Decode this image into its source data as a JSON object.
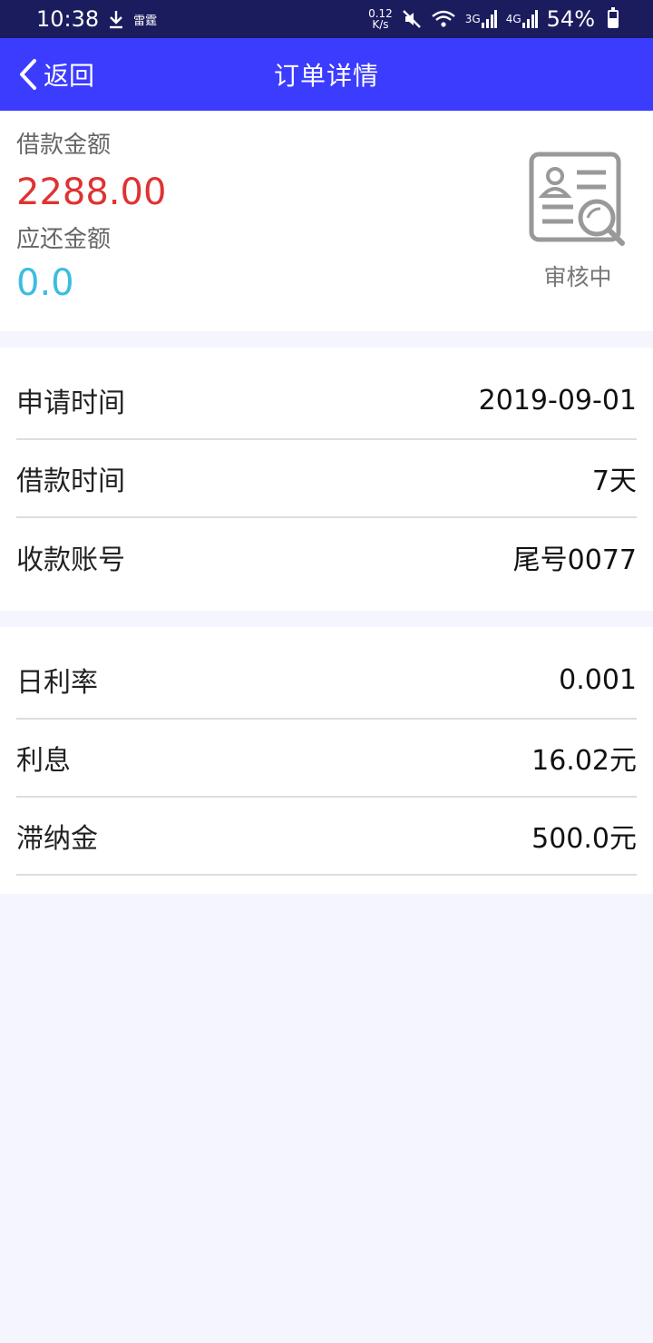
{
  "status_bar": {
    "time": "10:38",
    "notif_text": "雷霆",
    "net_speed_top": "0.12",
    "net_speed_bottom": "K/s",
    "sig1": "3G",
    "sig2": "4G",
    "battery": "54%",
    "battery_level": 0.54
  },
  "nav": {
    "back_label": "返回",
    "title": "订单详情"
  },
  "summary": {
    "loan_label": "借款金额",
    "loan_amount": "2288.00",
    "repay_label": "应还金额",
    "repay_amount": "0.0",
    "status": "审核中"
  },
  "details": [
    {
      "label": "申请时间",
      "value": "2019-09-01"
    },
    {
      "label": "借款时间",
      "value": "7天"
    },
    {
      "label": "收款账号",
      "value": "尾号0077"
    }
  ],
  "fees": [
    {
      "label": "日利率",
      "value": "0.001"
    },
    {
      "label": "利息",
      "value": "16.02元"
    },
    {
      "label": "滞纳金",
      "value": "500.0元"
    }
  ],
  "colors": {
    "status_bar_bg": "#1b1c5e",
    "nav_bg": "#3c3cff",
    "loan_amount": "#e03232",
    "repay_amount": "#3cbde0"
  },
  "icons": [
    "download-icon",
    "mute-icon",
    "wifi-icon",
    "signal-icon",
    "battery-icon",
    "back-chevron-icon",
    "review-document-icon"
  ]
}
